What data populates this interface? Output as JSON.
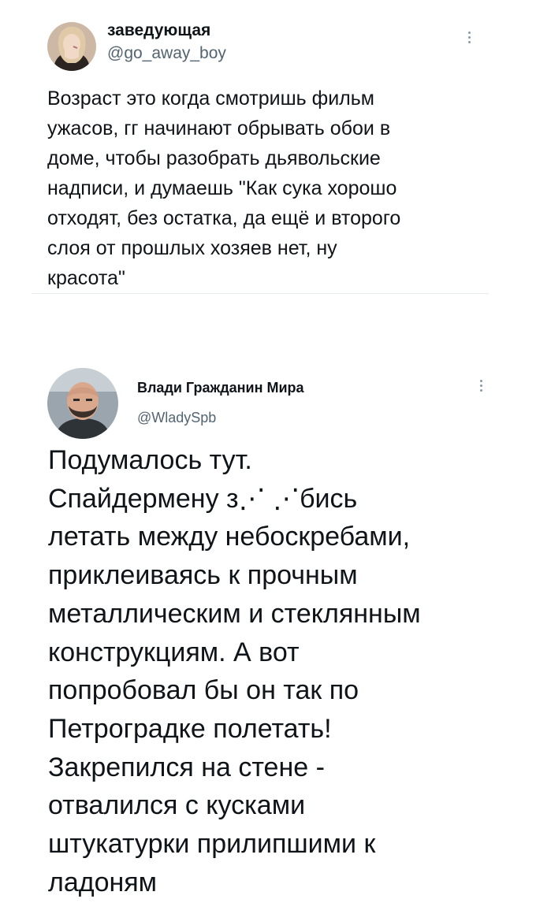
{
  "tweets": [
    {
      "author_name": "заведующая",
      "author_handle": "@go_away_boy",
      "avatar_icon": "profile-photo-woman",
      "more_icon": "vertical-ellipsis-icon",
      "text": "Возраст это когда смотришь фильм\nужасов, гг начинают обрывать обои в\nдоме, чтобы разобрать дьявольские\nнадписи, и думаешь \"Как сука хорошо\nотходят, без остатка, да ещё и второго\nслоя от прошлых хозяев нет, ну\nкрасота\""
    },
    {
      "author_name": "Влади Гражданин Мира",
      "author_handle": "@WladySpb",
      "avatar_icon": "profile-photo-man",
      "more_icon": "vertical-ellipsis-icon",
      "text": "Подумалось тут.\nСпайдермену з⋰ ⋰бись\nлетать между небоскребами,\nприклеиваясь к прочным\nметаллическим и стеклянным\nконструкциям. А вот\nпопробовал бы он так по\nПетроградке полетать!\nЗакрепился на стене -\nотвалился с кусками\nштукатурки прилипшими к\nладоням"
    }
  ],
  "colors": {
    "text": "#0f1419",
    "handle": "#536471",
    "divider": "#e6ecf0",
    "background": "#ffffff"
  }
}
